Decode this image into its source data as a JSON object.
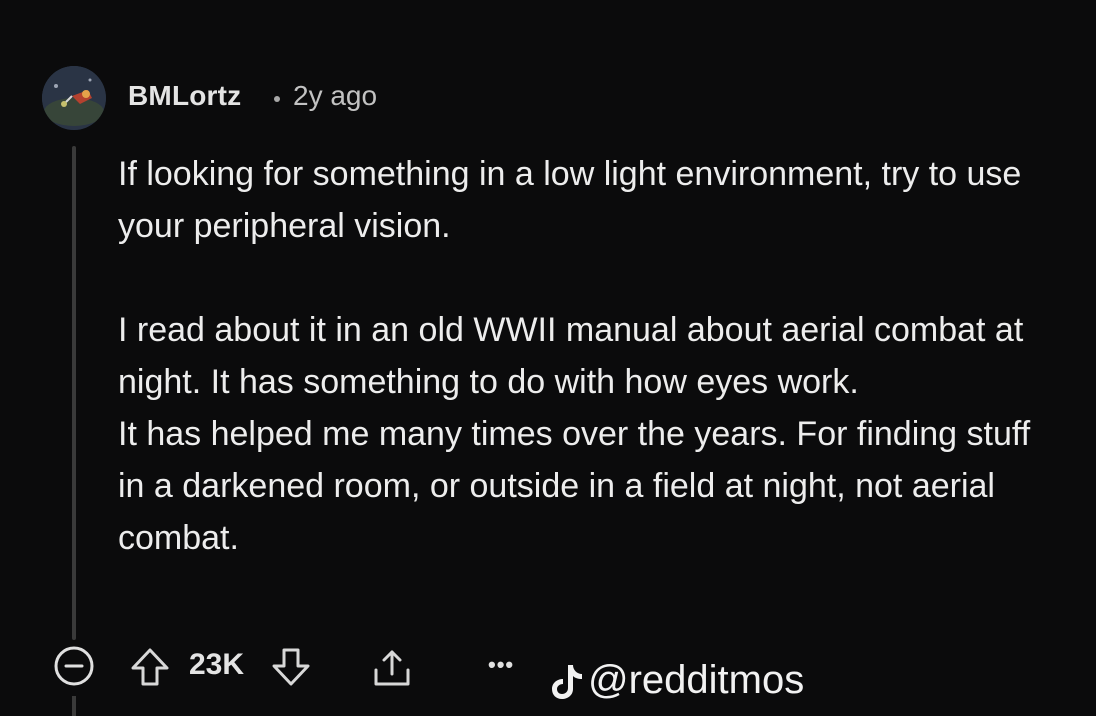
{
  "comment": {
    "author": "BMLortz",
    "separator": "•",
    "time": "2y ago",
    "avatar_icon": "avatar-icon",
    "paragraphs": [
      "If looking for something in a low light environment, try to use your peripheral vision.",
      "I read about it in an old WWII manual about aerial combat at night. It has something to do with how eyes work.",
      "It has helped me many times over the years. For finding stuff in a darkened room, or outside in a field at night, not aerial combat."
    ]
  },
  "actions": {
    "collapse_icon": "collapse-icon",
    "upvote_icon": "upvote-icon",
    "score": "23K",
    "downvote_icon": "downvote-icon",
    "share_icon": "share-icon",
    "more_label": "•••"
  },
  "watermark": {
    "icon": "tiktok-icon",
    "handle": "@redditmos"
  },
  "colors": {
    "background": "#0b0b0c",
    "text": "#ededed",
    "meta": "#c2c2c2",
    "thread": "#3a3a3a"
  }
}
